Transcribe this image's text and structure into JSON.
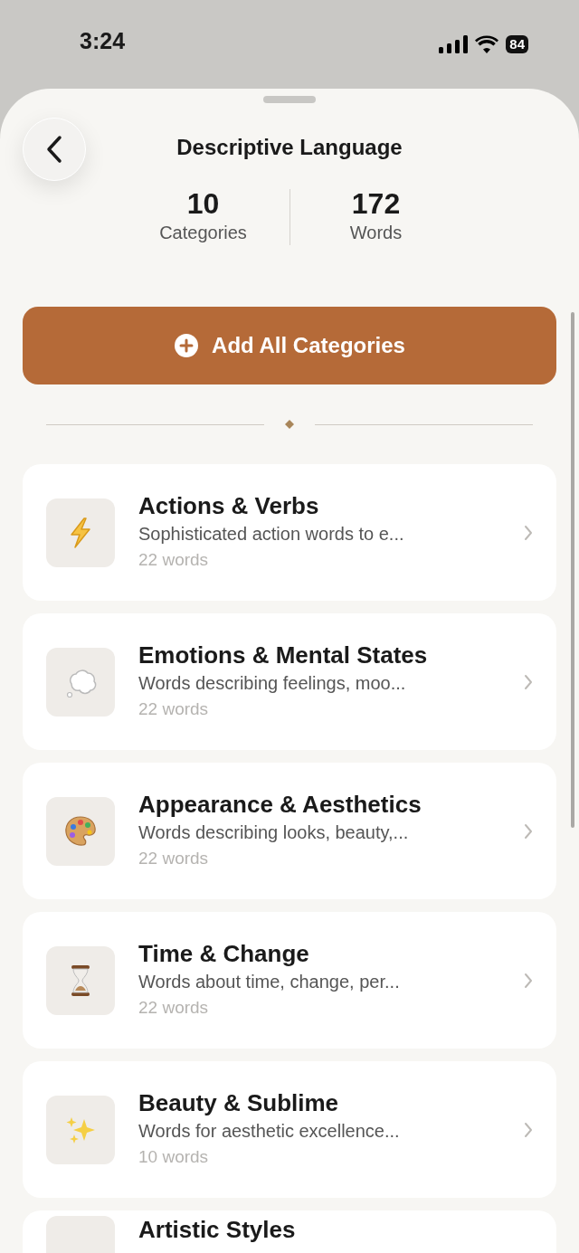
{
  "status_bar": {
    "time": "3:24",
    "battery": "84"
  },
  "header": {
    "title": "Descriptive Language"
  },
  "stats": [
    {
      "value": "10",
      "label": "Categories"
    },
    {
      "value": "172",
      "label": "Words"
    }
  ],
  "add_button": {
    "label": "Add All Categories"
  },
  "categories": [
    {
      "title": "Actions & Verbs",
      "description": "Sophisticated action words to e...",
      "count": "22 words"
    },
    {
      "title": "Emotions & Mental States",
      "description": "Words describing feelings, moo...",
      "count": "22 words"
    },
    {
      "title": "Appearance & Aesthetics",
      "description": "Words describing looks, beauty,...",
      "count": "22 words"
    },
    {
      "title": "Time & Change",
      "description": "Words about time, change, per...",
      "count": "22 words"
    },
    {
      "title": "Beauty & Sublime",
      "description": "Words for aesthetic excellence...",
      "count": "10 words"
    },
    {
      "title": "Artistic Styles"
    }
  ]
}
